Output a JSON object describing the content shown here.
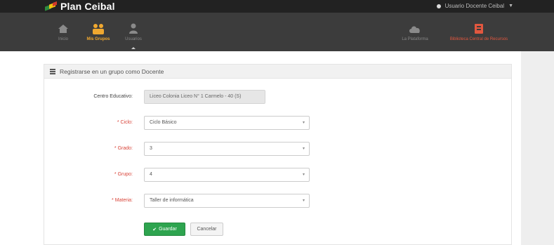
{
  "app": {
    "brand": "Plan Ceibal",
    "user_name": "Usuario Docente Ceibal"
  },
  "nav": {
    "items": [
      {
        "label": "Inicio",
        "icon": "home-icon"
      },
      {
        "label": "Mis Grupos",
        "icon": "groups-icon"
      },
      {
        "label": "Usuarios",
        "icon": "user-icon"
      },
      {
        "label": "La Plataforma",
        "icon": "cloud-icon"
      },
      {
        "label": "Biblioteca Central de Recursos",
        "icon": "book-icon"
      }
    ]
  },
  "panel": {
    "title": "Registrarse en un grupo como Docente"
  },
  "form": {
    "centro_label": "Centro Educativo:",
    "centro_value": "Liceo Colonia Liceo N° 1 Carmelo - 40 (S)",
    "ciclo_label": "* Ciclo:",
    "ciclo_value": "Ciclo Básico",
    "grado_label": "* Grado:",
    "grado_value": "3",
    "grupo_label": "* Grupo:",
    "grupo_value": "4",
    "materia_label": "* Materia:",
    "materia_value": "Taller de informática",
    "save_label": "Guardar",
    "cancel_label": "Cancelar"
  },
  "colors": {
    "nav_active": "#f0a830",
    "nav_alert": "#e2573f",
    "save_button": "#2ea44f",
    "required": "#d9453a"
  }
}
